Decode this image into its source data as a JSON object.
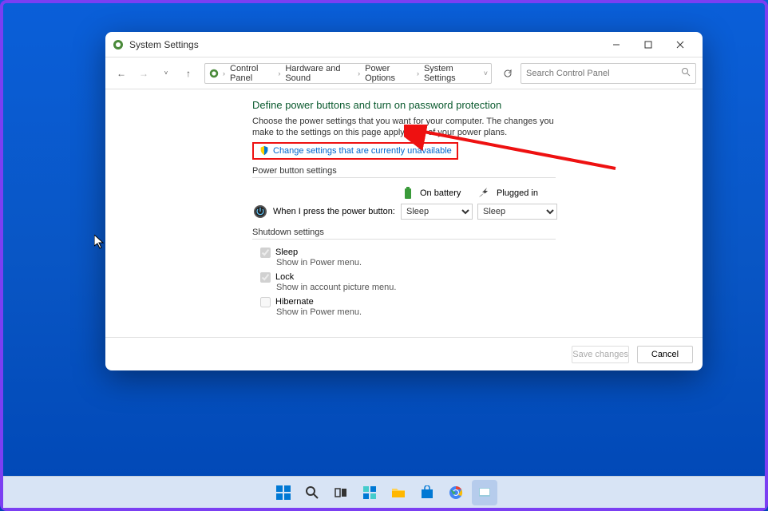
{
  "window": {
    "title": "System Settings"
  },
  "breadcrumb": {
    "items": [
      "Control Panel",
      "Hardware and Sound",
      "Power Options",
      "System Settings"
    ]
  },
  "search": {
    "placeholder": "Search Control Panel"
  },
  "heading": "Define power buttons and turn on password protection",
  "subtext": "Choose the power settings that you want for your computer. The changes you make to the settings on this page apply to all of your power plans.",
  "admin_link": "Change settings that are currently unavailable",
  "sections": {
    "power_button": "Power button settings",
    "shutdown": "Shutdown settings"
  },
  "columns": {
    "battery": "On battery",
    "plugged": "Plugged in"
  },
  "rows": {
    "press_power": "When I press the power button:"
  },
  "selects": {
    "battery_power": "Sleep",
    "plugged_power": "Sleep"
  },
  "checkboxes": {
    "sleep": {
      "label": "Sleep",
      "desc": "Show in Power menu."
    },
    "lock": {
      "label": "Lock",
      "desc": "Show in account picture menu."
    },
    "hibernate": {
      "label": "Hibernate",
      "desc": "Show in Power menu."
    }
  },
  "footer": {
    "save": "Save changes",
    "cancel": "Cancel"
  }
}
